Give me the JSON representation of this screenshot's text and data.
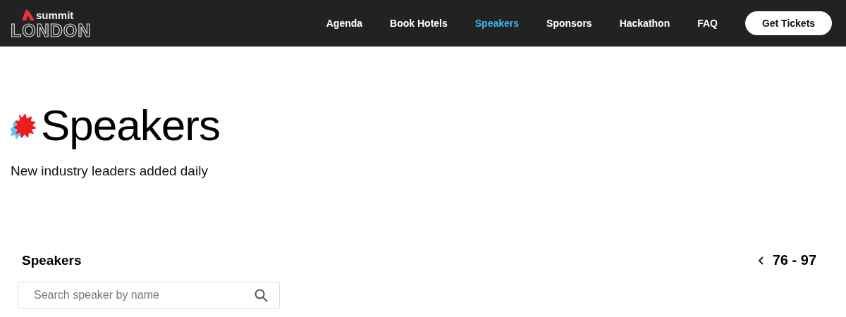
{
  "header": {
    "logo": {
      "top": "summit",
      "bottom": "LONDON"
    },
    "nav": [
      {
        "label": "Agenda",
        "selected": false
      },
      {
        "label": "Book Hotels",
        "selected": false
      },
      {
        "label": "Speakers",
        "selected": true
      },
      {
        "label": "Sponsors",
        "selected": false
      },
      {
        "label": "Hackathon",
        "selected": false
      },
      {
        "label": "FAQ",
        "selected": false
      }
    ],
    "cta": "Get Tickets"
  },
  "hero": {
    "title": "Speakers",
    "subtitle": "New industry leaders added daily"
  },
  "section": {
    "title": "Speakers",
    "pager": {
      "range": "76 - 97"
    },
    "search": {
      "placeholder": "Search speaker by name"
    }
  }
}
